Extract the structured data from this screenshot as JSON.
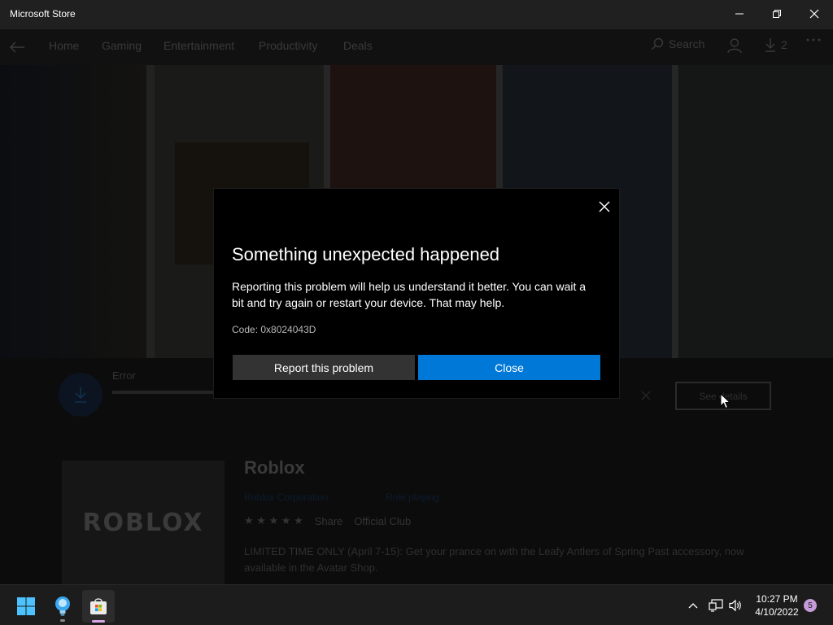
{
  "window": {
    "title": "Microsoft Store"
  },
  "nav": {
    "items": [
      "Home",
      "Gaming",
      "Entertainment",
      "Productivity",
      "Deals"
    ],
    "search_label": "Search",
    "downloads_count": "2"
  },
  "download": {
    "status": "Error",
    "see_details": "See details"
  },
  "app": {
    "name": "Roblox",
    "logo_text": "ROBLOX",
    "publisher": "Roblox Corporation",
    "category": "Role playing"
  },
  "rating_row": {
    "share": "Share",
    "official_club": "Official Club"
  },
  "description": "LIMITED TIME ONLY (April 7-15): Get your prance on with the Leafy Antlers of Spring Past accessory, now available in the Avatar Shop.",
  "dialog": {
    "title": "Something unexpected happened",
    "message": "Reporting this problem will help us understand it better. You can wait a bit and try again or restart your device. That may help.",
    "code": "Code: 0x8024043D",
    "report_button": "Report this problem",
    "close_button": "Close"
  },
  "taskbar": {
    "time": "10:27 PM",
    "date": "4/10/2022",
    "notification_count": "5"
  },
  "colors": {
    "accent": "#0078d7",
    "dialog_bg": "#000000",
    "secondary_button": "#333333",
    "taskbar_bg": "#1c1c1c"
  }
}
